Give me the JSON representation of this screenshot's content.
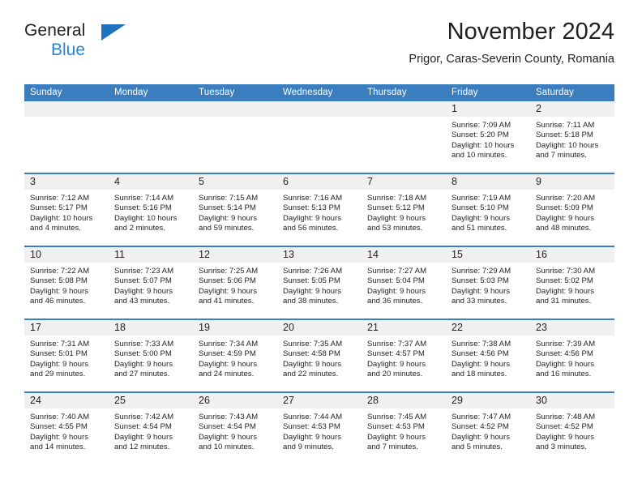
{
  "brand": {
    "name_part1": "General",
    "name_part2": "Blue",
    "color_dark": "#231f20",
    "color_blue": "#2387d4",
    "triangle_color": "#1f72bd"
  },
  "header": {
    "title": "November 2024",
    "subtitle": "Prigor, Caras-Severin County, Romania"
  },
  "theme": {
    "header_bg": "#3a7ebf",
    "header_text": "#ffffff",
    "daynum_bg": "#f0f0f0",
    "body_bg": "#ffffff",
    "text": "#231f20"
  },
  "weekday_headers": [
    "Sunday",
    "Monday",
    "Tuesday",
    "Wednesday",
    "Thursday",
    "Friday",
    "Saturday"
  ],
  "weeks": [
    [
      {
        "day": "",
        "lines": []
      },
      {
        "day": "",
        "lines": []
      },
      {
        "day": "",
        "lines": []
      },
      {
        "day": "",
        "lines": []
      },
      {
        "day": "",
        "lines": []
      },
      {
        "day": "1",
        "lines": [
          "Sunrise: 7:09 AM",
          "Sunset: 5:20 PM",
          "Daylight: 10 hours",
          "and 10 minutes."
        ]
      },
      {
        "day": "2",
        "lines": [
          "Sunrise: 7:11 AM",
          "Sunset: 5:18 PM",
          "Daylight: 10 hours",
          "and 7 minutes."
        ]
      }
    ],
    [
      {
        "day": "3",
        "lines": [
          "Sunrise: 7:12 AM",
          "Sunset: 5:17 PM",
          "Daylight: 10 hours",
          "and 4 minutes."
        ]
      },
      {
        "day": "4",
        "lines": [
          "Sunrise: 7:14 AM",
          "Sunset: 5:16 PM",
          "Daylight: 10 hours",
          "and 2 minutes."
        ]
      },
      {
        "day": "5",
        "lines": [
          "Sunrise: 7:15 AM",
          "Sunset: 5:14 PM",
          "Daylight: 9 hours",
          "and 59 minutes."
        ]
      },
      {
        "day": "6",
        "lines": [
          "Sunrise: 7:16 AM",
          "Sunset: 5:13 PM",
          "Daylight: 9 hours",
          "and 56 minutes."
        ]
      },
      {
        "day": "7",
        "lines": [
          "Sunrise: 7:18 AM",
          "Sunset: 5:12 PM",
          "Daylight: 9 hours",
          "and 53 minutes."
        ]
      },
      {
        "day": "8",
        "lines": [
          "Sunrise: 7:19 AM",
          "Sunset: 5:10 PM",
          "Daylight: 9 hours",
          "and 51 minutes."
        ]
      },
      {
        "day": "9",
        "lines": [
          "Sunrise: 7:20 AM",
          "Sunset: 5:09 PM",
          "Daylight: 9 hours",
          "and 48 minutes."
        ]
      }
    ],
    [
      {
        "day": "10",
        "lines": [
          "Sunrise: 7:22 AM",
          "Sunset: 5:08 PM",
          "Daylight: 9 hours",
          "and 46 minutes."
        ]
      },
      {
        "day": "11",
        "lines": [
          "Sunrise: 7:23 AM",
          "Sunset: 5:07 PM",
          "Daylight: 9 hours",
          "and 43 minutes."
        ]
      },
      {
        "day": "12",
        "lines": [
          "Sunrise: 7:25 AM",
          "Sunset: 5:06 PM",
          "Daylight: 9 hours",
          "and 41 minutes."
        ]
      },
      {
        "day": "13",
        "lines": [
          "Sunrise: 7:26 AM",
          "Sunset: 5:05 PM",
          "Daylight: 9 hours",
          "and 38 minutes."
        ]
      },
      {
        "day": "14",
        "lines": [
          "Sunrise: 7:27 AM",
          "Sunset: 5:04 PM",
          "Daylight: 9 hours",
          "and 36 minutes."
        ]
      },
      {
        "day": "15",
        "lines": [
          "Sunrise: 7:29 AM",
          "Sunset: 5:03 PM",
          "Daylight: 9 hours",
          "and 33 minutes."
        ]
      },
      {
        "day": "16",
        "lines": [
          "Sunrise: 7:30 AM",
          "Sunset: 5:02 PM",
          "Daylight: 9 hours",
          "and 31 minutes."
        ]
      }
    ],
    [
      {
        "day": "17",
        "lines": [
          "Sunrise: 7:31 AM",
          "Sunset: 5:01 PM",
          "Daylight: 9 hours",
          "and 29 minutes."
        ]
      },
      {
        "day": "18",
        "lines": [
          "Sunrise: 7:33 AM",
          "Sunset: 5:00 PM",
          "Daylight: 9 hours",
          "and 27 minutes."
        ]
      },
      {
        "day": "19",
        "lines": [
          "Sunrise: 7:34 AM",
          "Sunset: 4:59 PM",
          "Daylight: 9 hours",
          "and 24 minutes."
        ]
      },
      {
        "day": "20",
        "lines": [
          "Sunrise: 7:35 AM",
          "Sunset: 4:58 PM",
          "Daylight: 9 hours",
          "and 22 minutes."
        ]
      },
      {
        "day": "21",
        "lines": [
          "Sunrise: 7:37 AM",
          "Sunset: 4:57 PM",
          "Daylight: 9 hours",
          "and 20 minutes."
        ]
      },
      {
        "day": "22",
        "lines": [
          "Sunrise: 7:38 AM",
          "Sunset: 4:56 PM",
          "Daylight: 9 hours",
          "and 18 minutes."
        ]
      },
      {
        "day": "23",
        "lines": [
          "Sunrise: 7:39 AM",
          "Sunset: 4:56 PM",
          "Daylight: 9 hours",
          "and 16 minutes."
        ]
      }
    ],
    [
      {
        "day": "24",
        "lines": [
          "Sunrise: 7:40 AM",
          "Sunset: 4:55 PM",
          "Daylight: 9 hours",
          "and 14 minutes."
        ]
      },
      {
        "day": "25",
        "lines": [
          "Sunrise: 7:42 AM",
          "Sunset: 4:54 PM",
          "Daylight: 9 hours",
          "and 12 minutes."
        ]
      },
      {
        "day": "26",
        "lines": [
          "Sunrise: 7:43 AM",
          "Sunset: 4:54 PM",
          "Daylight: 9 hours",
          "and 10 minutes."
        ]
      },
      {
        "day": "27",
        "lines": [
          "Sunrise: 7:44 AM",
          "Sunset: 4:53 PM",
          "Daylight: 9 hours",
          "and 9 minutes."
        ]
      },
      {
        "day": "28",
        "lines": [
          "Sunrise: 7:45 AM",
          "Sunset: 4:53 PM",
          "Daylight: 9 hours",
          "and 7 minutes."
        ]
      },
      {
        "day": "29",
        "lines": [
          "Sunrise: 7:47 AM",
          "Sunset: 4:52 PM",
          "Daylight: 9 hours",
          "and 5 minutes."
        ]
      },
      {
        "day": "30",
        "lines": [
          "Sunrise: 7:48 AM",
          "Sunset: 4:52 PM",
          "Daylight: 9 hours",
          "and 3 minutes."
        ]
      }
    ]
  ]
}
